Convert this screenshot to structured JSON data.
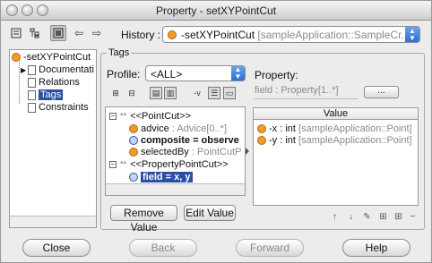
{
  "window": {
    "title": "Property - setXYPointCut"
  },
  "toolbar": {
    "history_label": "History :",
    "history_value": "-setXYPointCut",
    "history_suffix": "[sampleApplication::SampleCr..."
  },
  "tree": {
    "root": "-setXYPointCut",
    "items": [
      {
        "label": "Documentati"
      },
      {
        "label": "Relations"
      },
      {
        "label": "Tags"
      },
      {
        "label": "Constraints"
      }
    ]
  },
  "tags": {
    "group_label": "Tags",
    "profile_label": "Profile:",
    "profile_value": "<ALL>",
    "toggle_text": "-v",
    "nodes": [
      {
        "dots": "°°",
        "text": "<<PointCut>>"
      },
      {
        "name": "advice",
        "type": ": Advice[0..*]"
      },
      {
        "name": "composite = observe",
        "type": ""
      },
      {
        "name": "selectedBy",
        "type": ": PointCutP"
      },
      {
        "dots": "°°",
        "text": "<<PropertyPointCut>>"
      },
      {
        "name": "field = x, y",
        "type": ""
      }
    ],
    "remove_button": "Remove Value",
    "edit_button": "Edit Value"
  },
  "property": {
    "label": "Property:",
    "field_text": "field : Property[1..*]",
    "browse_button": "...",
    "value_header": "Value",
    "values": [
      {
        "name": "-x",
        "type": ": int",
        "context": "[sampleApplication::Point]"
      },
      {
        "name": "-y",
        "type": ": int",
        "context": "[sampleApplication::Point]"
      }
    ]
  },
  "buttons": {
    "close": "Close",
    "back": "Back",
    "forward": "Forward",
    "help": "Help"
  }
}
